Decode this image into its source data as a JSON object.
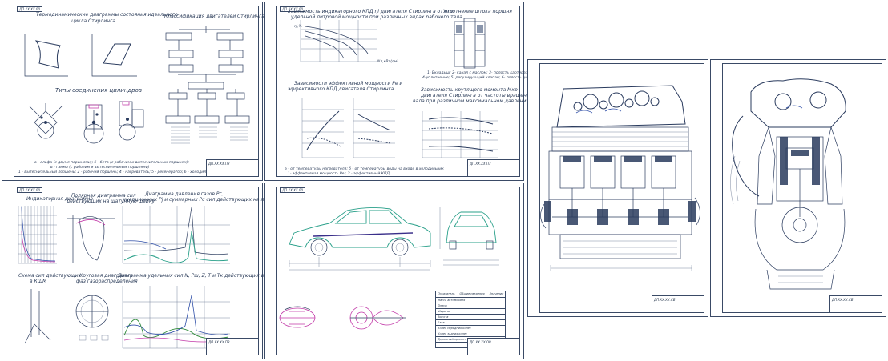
{
  "sheets": [
    {
      "id": "s1",
      "tag": "ДП.ХХ.ХХ.00",
      "title_main": "Термодинамические диаграммы состояния идеального",
      "title_main2": "цикла Стирлинга",
      "title_class": "Классификация двигателей Стирлинга",
      "title_types": "Типы соединения цилиндров",
      "caption1": "а - альфа (с двумя поршнями); б - бета (с рабочим и вытеснительным поршнем);",
      "caption2": "в - гамма (с рабочим и вытеснительным поршнями)",
      "caption3": "1 - Вытеснительный поршень; 2 - рабочий поршень; 4 - нагреватель; 5 - регенератор; 6 - холодильник",
      "stamp": "ДП.ХХ.ХХ.ПЗ"
    },
    {
      "id": "s2",
      "tag": "ДП.ХХ.ХХ.00",
      "title_a": "Зависимость индикаторного КПД ηi двигателя Стирлинга от его",
      "title_a2": "удельной литровой мощности при различных видах рабочего тела",
      "title_b": "Уплотнение штока поршня",
      "title_c": "Зависимости эффективной мощности Pe и",
      "title_c2": "эффективного КПД двигателя Стирлинга",
      "title_d": "Зависимость крутящего момента Мкр",
      "title_d2": "двигателя Стирлинга от частоты вращения",
      "title_d3": "вала при различном максимальном давлении",
      "axis_eta": "ηi,%",
      "axis_nl": "Nл,кВт/дм³",
      "legend_b": "1- Вкладыш; 2- канал с маслом; 3- полость картера;",
      "legend_b2": "4-уплотнение; 5- регулирующий клапан; 6- полость цилиндра",
      "caption": "а - от температуры нагревателя; б - от температуры воды на входе в холодильник",
      "caption2": "1- эффективная мощность Pe ; 2 - эффективный КПД",
      "stamp": "ДП.ХХ.ХХ.ПЗ"
    },
    {
      "id": "s3",
      "tag": "ДП.ХХ.ХХ.00",
      "title_a": "Индикаторная диаграмма",
      "title_b": "Полярная диаграмма сил",
      "title_b2": "действующих на шатунную шейку",
      "title_c": "Диаграмма давления газов Pг,",
      "title_c2": "инерционных Pj и суммарных Pс сил действующих на поршень",
      "title_d": "Схема сил действующих",
      "title_d2": "в КШМ",
      "title_e": "Круговая диаграмма",
      "title_e2": "фаз газораспределения",
      "title_f": "Диаграмма удельных сил N, Pш, Z, T и Tк действующих в ДВС",
      "stamp": "ДП.ХХ.ХХ.ПЗ"
    },
    {
      "id": "s4",
      "tag": "ДП.ХХ.ХХ.00",
      "table_header": [
        "Показатель",
        "Общие сведения",
        "Значение"
      ],
      "table_rows": [
        "Масса автомобиля",
        "Длина",
        "Ширина",
        "Высота",
        "База",
        "Колея передних колес",
        "Колея задних колес",
        "Дорожный просвет"
      ],
      "stamp": "ДП.ХХ.ХХ.ОВ"
    },
    {
      "id": "s5",
      "stamp": "ДП.ХХ.ХХ.СБ"
    },
    {
      "id": "s6",
      "stamp": "ДП.ХХ.ХХ.СБ"
    }
  ],
  "colors": {
    "line": "#2a3b5e",
    "teal": "#2aa08a",
    "magenta": "#c23aa8",
    "green": "#2f8a3a",
    "blue": "#2f4fa8"
  }
}
